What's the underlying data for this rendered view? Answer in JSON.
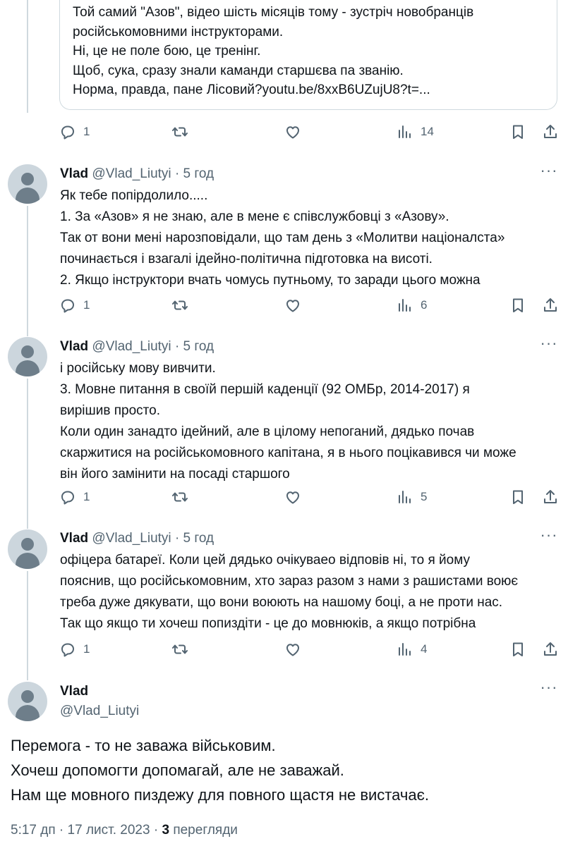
{
  "quoted_tweet": {
    "lines": [
      "Той самий \"Азов\", відео шість місяців тому - зустріч новобранців",
      "російськомовними інструкторами.",
      "Ні, це не поле бою, це тренінг.",
      "Щоб, сука, сразу знали каманди старшєва па званію.",
      "Норма, правда, пане Лісовий?youtu.be/8xxB6UZujU8?t=..."
    ],
    "actions": {
      "replies": "1",
      "reposts": "",
      "likes": "",
      "views": "14"
    }
  },
  "replies": [
    {
      "name": "Vlad",
      "handle": "@Vlad_Liutyi",
      "dot": "·",
      "time": "5 год",
      "lines": [
        "Як тебе попірдолило.....",
        "1. За «Азов» я не знаю, але в мене є співслужбовці з «Азову».",
        "Так от вони мені нарозповідали, що там день з «Молитви націоналста»",
        "починається і взагалі ідейно-політична підготовка на висоті.",
        "2. Якщо інструктори вчать чомусь путньому, то заради цього можна"
      ],
      "actions": {
        "replies": "1",
        "views": "6"
      }
    },
    {
      "name": "Vlad",
      "handle": "@Vlad_Liutyi",
      "dot": "·",
      "time": "5 год",
      "lines": [
        "і російську мову вивчити.",
        "3. Мовне питання в своїй першій каденції (92 ОМБр, 2014-2017) я",
        "вирішив просто.",
        "Коли один занадто ідейний, але в цілому непоганий, дядько почав",
        "скаржитися на російськомовного капітана, я в нього поцікавився чи може",
        "він його замінити на посаді старшого"
      ],
      "actions": {
        "replies": "1",
        "views": "5"
      }
    },
    {
      "name": "Vlad",
      "handle": "@Vlad_Liutyi",
      "dot": "·",
      "time": "5 год",
      "lines": [
        "офіцера батареї. Коли цей дядько очікуваео відповів ні, то я йому",
        "пояснив, що російськомовним, хто зараз разом з нами з рашистами воює",
        "треба дуже дякувати, що вони воюють на нашому боці, а не проти нас.",
        "Так що якщо ти хочеш попиздіти - це до мовнюків, а якщо потрібна"
      ],
      "actions": {
        "replies": "1",
        "views": "4"
      }
    }
  ],
  "main_tweet": {
    "name": "Vlad",
    "handle": "@Vlad_Liutyi",
    "lines": [
      "Перемога - то не заважа військовим.",
      "Хочеш допомогти допомагай, але не заважай.",
      "Нам ще мовного пиздежу для повного щастя не вистачає."
    ],
    "time": "5:17 дп",
    "sep1": "·",
    "date": "17 лист. 2023",
    "sep2": "·",
    "views_count": "3",
    "views_label": "перегляди"
  },
  "icons": {
    "reply": "reply-icon",
    "repost": "repost-icon",
    "like": "heart-icon",
    "views": "views-icon",
    "bookmark": "bookmark-icon",
    "share": "share-icon",
    "more": "more-icon",
    "avatar": "default-avatar-icon"
  },
  "colors": {
    "text": "#0f1419",
    "secondary": "#536471",
    "border": "#cfd9de",
    "avatar_bg": "#ccd6dd"
  }
}
